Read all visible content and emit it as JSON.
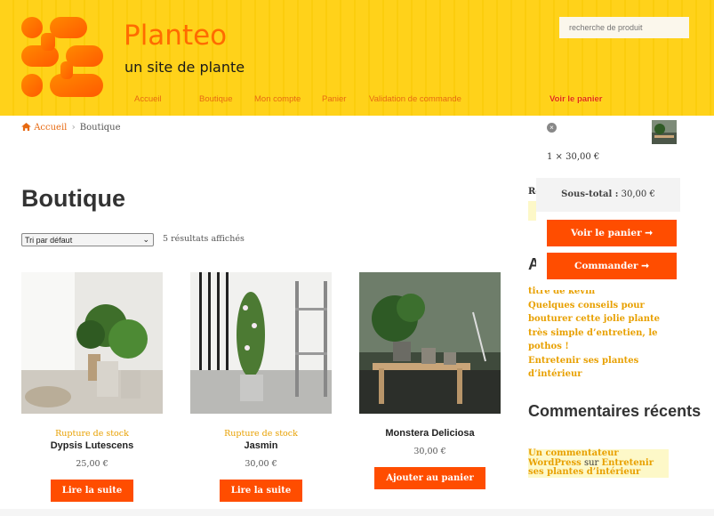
{
  "header": {
    "site_title": "Planteo",
    "site_description": "un site de plante",
    "search_placeholder": "recherche de produit"
  },
  "nav": {
    "items": [
      "Accueil",
      "Boutique",
      "Mon compte",
      "Panier",
      "Validation de commande"
    ],
    "cart_link": "Voir le panier"
  },
  "breadcrumb": {
    "home": "Accueil",
    "separator": "›",
    "current": "Boutique"
  },
  "main": {
    "title": "Boutique",
    "sort_selected": "Tri par défaut",
    "result_count": "5 résultats affichés"
  },
  "products": [
    {
      "status": "Rupture de stock",
      "name": "Dypsis Lutescens",
      "price": "25,00 €",
      "button": "Lire la suite"
    },
    {
      "status": "Rupture de stock",
      "name": "Jasmin",
      "price": "30,00 €",
      "button": "Lire la suite"
    },
    {
      "status": "",
      "name": "Monstera Deliciosa",
      "price": "30,00 €",
      "button": "Ajouter au panier"
    }
  ],
  "sidebar": {
    "fragment_re": "Re",
    "fragment_a": "A",
    "recent_posts": [
      "titre de kevin",
      "Quelques conseils pour bouturer cette jolie plante très simple d’entretien, le pothos !",
      "Entretenir ses plantes d’intérieur"
    ],
    "comments_title": "Commentaires récents",
    "comment": {
      "author": "Un commentateur WordPress",
      "on": "sur",
      "post": "Entretenir ses plantes d’intérieur"
    }
  },
  "minicart": {
    "remove_icon": "×",
    "quantity_line": "1 × 30,00 €",
    "subtotal_label": "Sous-total :",
    "subtotal_value": "30,00 €",
    "view_cart": "Voir le panier ➞",
    "checkout": "Commander ➞"
  },
  "colors": {
    "header_bg": "#ffd21a",
    "accent": "#ff6b00",
    "button": "#ff4d00",
    "link": "#e8a000"
  }
}
